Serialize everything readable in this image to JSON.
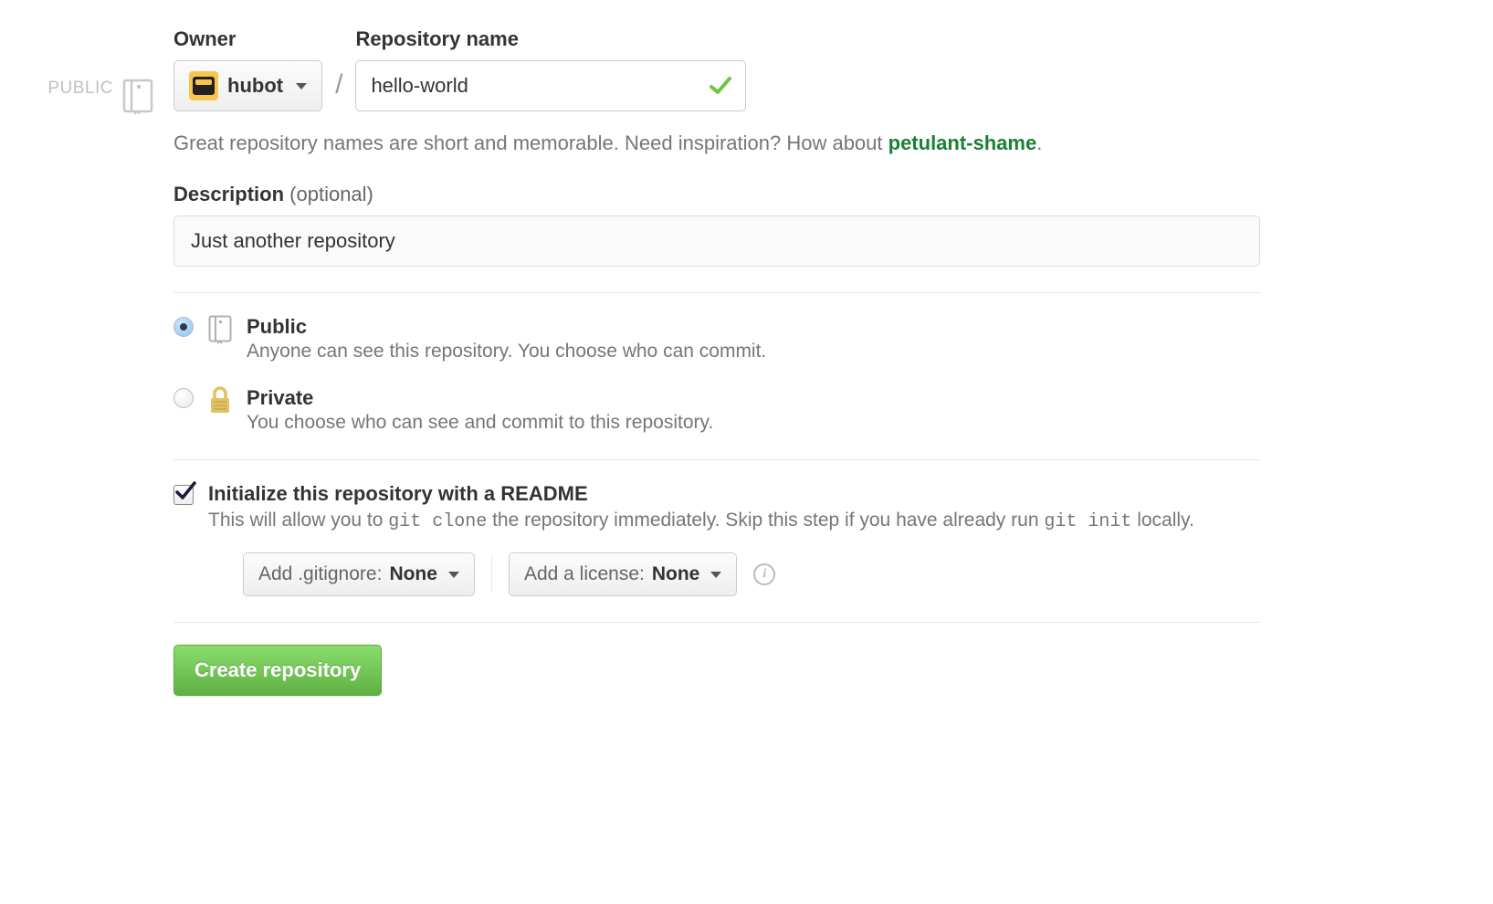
{
  "side_label": "PUBLIC",
  "owner": {
    "label": "Owner",
    "selected": "hubot"
  },
  "name": {
    "label": "Repository name",
    "value": "hello-world"
  },
  "hint": {
    "text_before": "Great repository names are short and memorable. Need inspiration? How about ",
    "suggestion": "petulant-shame",
    "text_after": "."
  },
  "description": {
    "label_bold": "Description",
    "label_optional": "(optional)",
    "value": "Just another repository"
  },
  "visibility": {
    "public": {
      "title": "Public",
      "desc": "Anyone can see this repository. You choose who can commit."
    },
    "private": {
      "title": "Private",
      "desc": "You choose who can see and commit to this repository."
    }
  },
  "initialize": {
    "title": "Initialize this repository with a README",
    "desc_before": "This will allow you to ",
    "code1": "git clone",
    "desc_mid": " the repository immediately. Skip this step if you have already run ",
    "code2": "git init",
    "desc_after": " locally."
  },
  "gitignore": {
    "label": "Add .gitignore: ",
    "value": "None"
  },
  "license": {
    "label": "Add a license: ",
    "value": "None"
  },
  "submit": "Create repository"
}
